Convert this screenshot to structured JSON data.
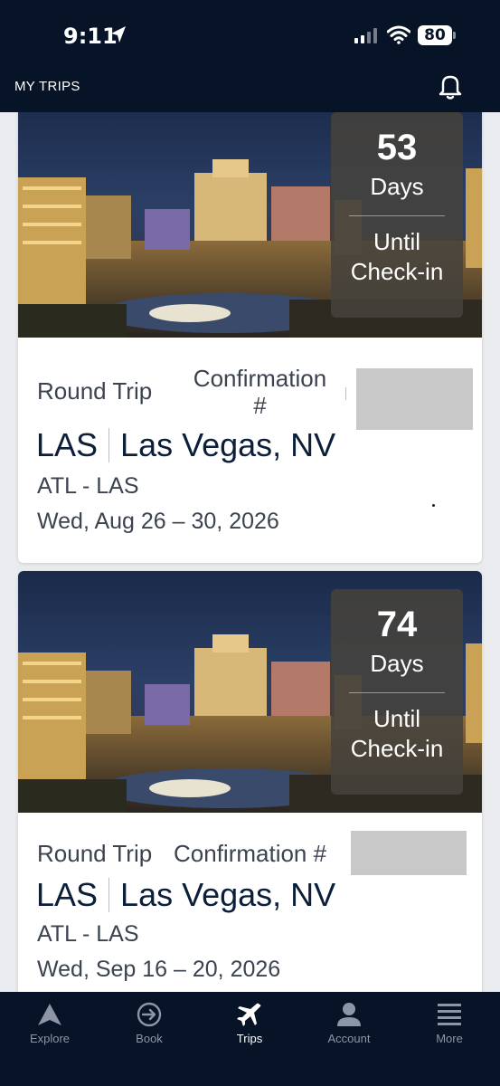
{
  "status_bar": {
    "time": "9:11",
    "battery": "80"
  },
  "header": {
    "title": "MY TRIPS"
  },
  "trips": [
    {
      "countdown_number": "53",
      "countdown_unit": "Days",
      "countdown_label_1": "Until",
      "countdown_label_2": "Check-in",
      "trip_type": "Round Trip",
      "confirmation_label_1": "Confirmation",
      "confirmation_label_2": "#",
      "airport_code": "LAS",
      "city": "Las Vegas, NV",
      "route": "ATL - LAS",
      "dates": "Wed, Aug 26 – 30, 2026"
    },
    {
      "countdown_number": "74",
      "countdown_unit": "Days",
      "countdown_label_1": "Until",
      "countdown_label_2": "Check-in",
      "trip_type": "Round Trip",
      "confirmation_label": "Confirmation #",
      "airport_code": "LAS",
      "city": "Las Vegas, NV",
      "route": "ATL - LAS",
      "dates": "Wed, Sep 16 – 20, 2026"
    }
  ],
  "tab_bar": {
    "items": [
      {
        "label": "Explore",
        "icon": "explore-icon"
      },
      {
        "label": "Book",
        "icon": "book-icon"
      },
      {
        "label": "Trips",
        "icon": "plane-icon"
      },
      {
        "label": "Account",
        "icon": "account-icon"
      },
      {
        "label": "More",
        "icon": "menu-icon"
      }
    ],
    "active": "Trips"
  },
  "colors": {
    "nav_background": "#071327",
    "text_primary": "#0b1f3a",
    "tab_inactive": "#8d96a6"
  }
}
